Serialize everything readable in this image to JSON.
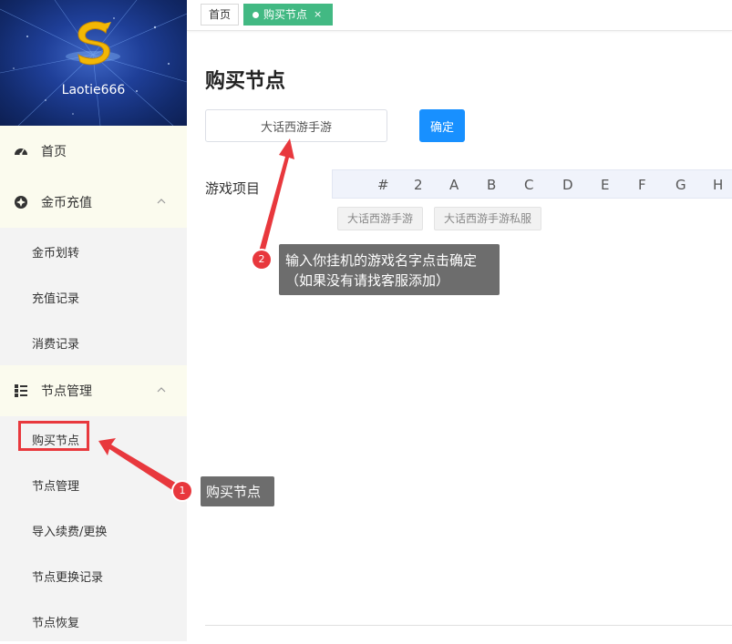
{
  "brand": {
    "name": "Laotie666",
    "logo": "s-coin-logo",
    "colors": {
      "gold": "#f2b705",
      "blue": "#1f3f98"
    }
  },
  "sidebar": {
    "items": [
      {
        "label": "首页",
        "icon": "dashboard-icon",
        "level": 1
      },
      {
        "label": "金币充值",
        "icon": "coin-icon",
        "level": 1,
        "expanded": true
      },
      {
        "label": "金币划转",
        "level": 2
      },
      {
        "label": "充值记录",
        "level": 2
      },
      {
        "label": "消费记录",
        "level": 2
      },
      {
        "label": "节点管理",
        "icon": "node-tree-icon",
        "level": 1,
        "expanded": true
      },
      {
        "label": "购买节点",
        "level": 2,
        "active": true
      },
      {
        "label": "节点管理",
        "level": 2
      },
      {
        "label": "导入续费/更换",
        "level": 2
      },
      {
        "label": "节点更换记录",
        "level": 2
      },
      {
        "label": "节点恢复",
        "level": 2
      }
    ]
  },
  "tabs": {
    "home": "首页",
    "active": "购买节点",
    "close": "×",
    "active_color": "#42b983"
  },
  "main": {
    "title": "购买节点",
    "search_value": "大话西游手游",
    "confirm_label": "确定",
    "confirm_color": "#1890ff",
    "section_label": "游戏项目",
    "letters": [
      "#",
      "2",
      "A",
      "B",
      "C",
      "D",
      "E",
      "F",
      "G",
      "H"
    ],
    "chips": [
      "大话西游手游",
      "大话西游手游私服"
    ]
  },
  "annotations": {
    "callout1": {
      "num": "1",
      "text": "购买节点"
    },
    "callout2": {
      "num": "2",
      "line1": "输入你挂机的游戏名字点击确定",
      "line2": "（如果没有请找客服添加）"
    },
    "color": "#e8383d"
  }
}
